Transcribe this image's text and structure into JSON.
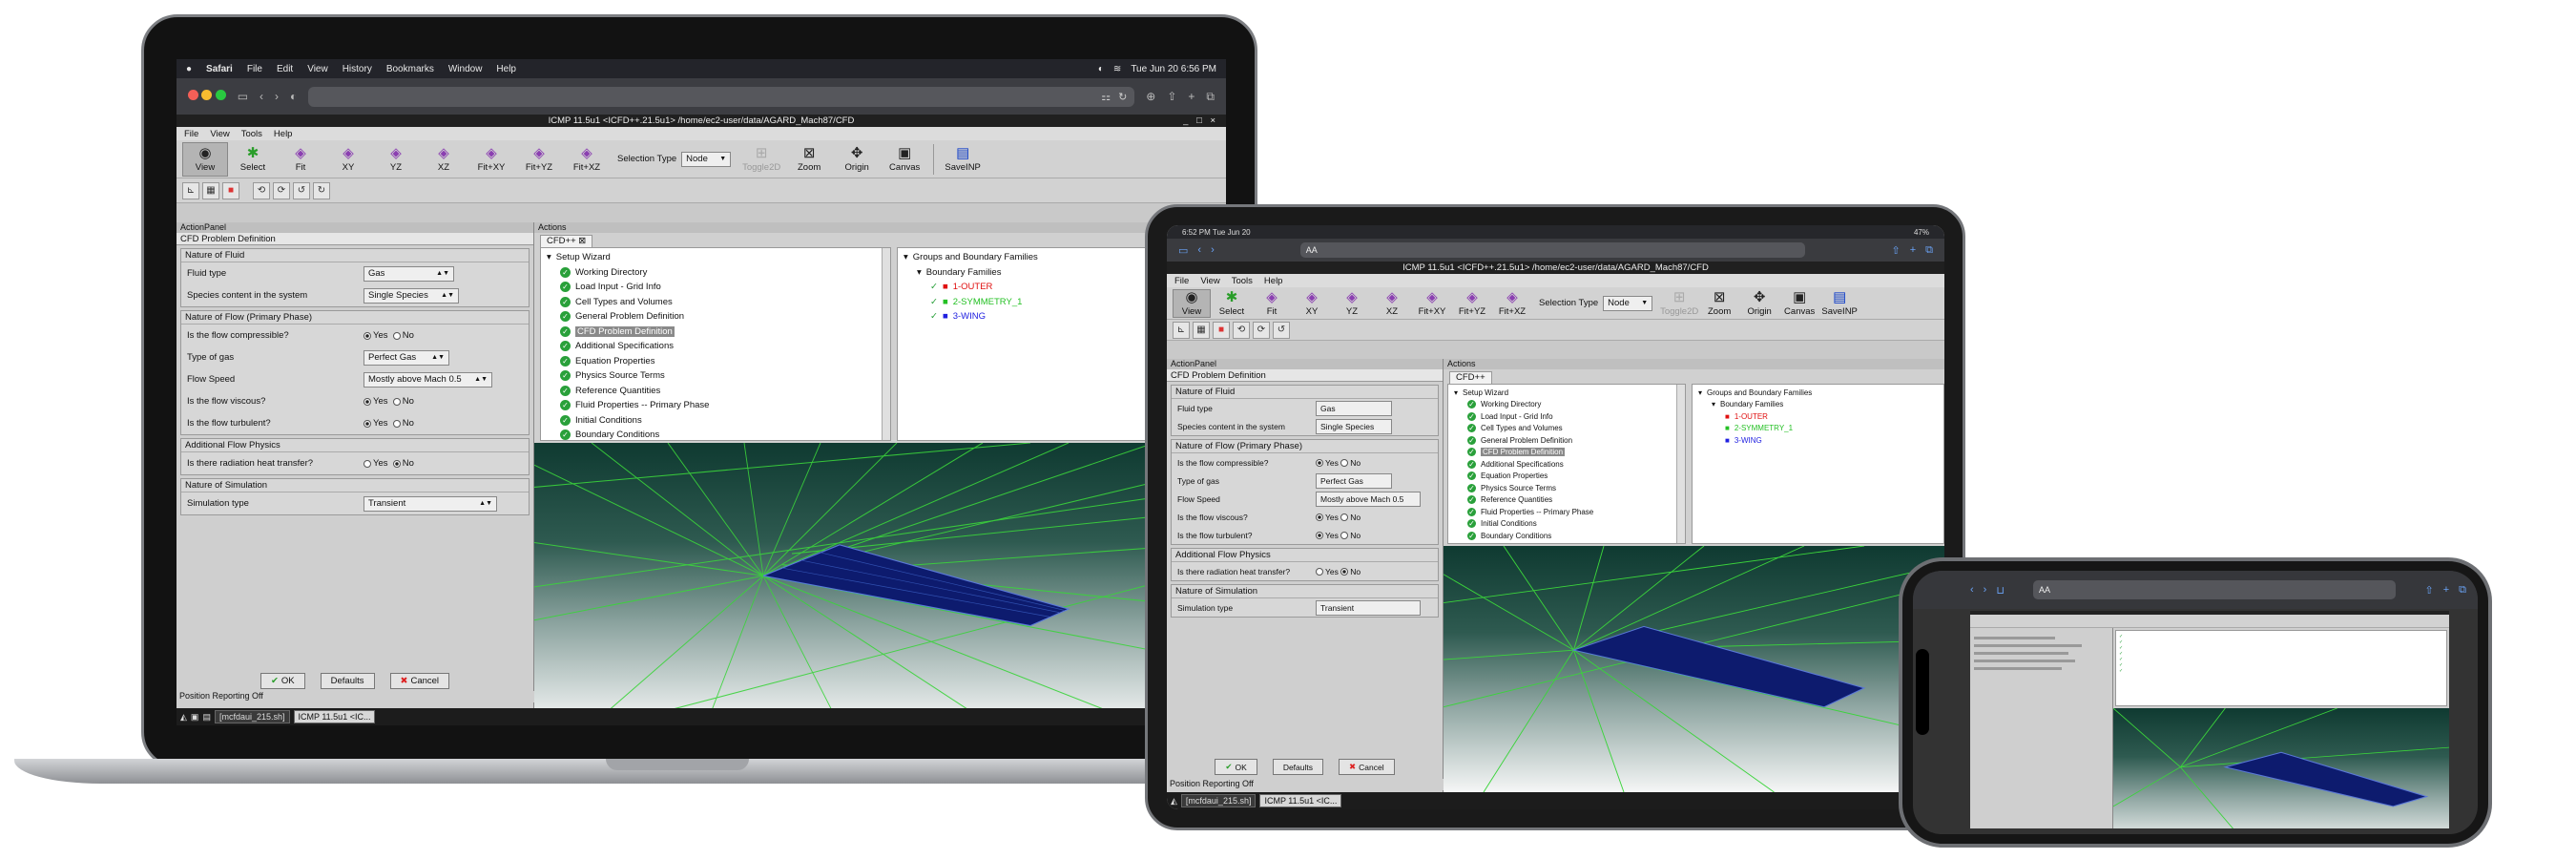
{
  "mac_menubar": {
    "app": "Safari",
    "items": [
      "File",
      "Edit",
      "View",
      "History",
      "Bookmarks",
      "Window",
      "Help"
    ],
    "clock": "Tue Jun 20  6:56 PM"
  },
  "window_title": "ICMP 11.5u1 <ICFD++.21.5u1>  /home/ec2-user/data/AGARD_Mach87/CFD",
  "app_menu": [
    "File",
    "View",
    "Tools",
    "Help"
  ],
  "toolbar": {
    "buttons": [
      {
        "label": "View",
        "icon": "eye-icon",
        "glyph": "👁"
      },
      {
        "label": "Select",
        "icon": "select-icon",
        "glyph": "✱"
      },
      {
        "label": "Fit",
        "icon": "fit-icon",
        "glyph": "⬚"
      },
      {
        "label": "XY",
        "icon": "xy-icon",
        "glyph": "◈"
      },
      {
        "label": "YZ",
        "icon": "yz-icon",
        "glyph": "◈"
      },
      {
        "label": "XZ",
        "icon": "xz-icon",
        "glyph": "◈"
      },
      {
        "label": "Fit+XY",
        "icon": "fit-xy-icon",
        "glyph": "◈"
      },
      {
        "label": "Fit+YZ",
        "icon": "fit-yz-icon",
        "glyph": "◈"
      },
      {
        "label": "Fit+XZ",
        "icon": "fit-xz-icon",
        "glyph": "◈"
      }
    ],
    "selection_type_label": "Selection Type",
    "selection_type_value": "Node",
    "toggle2d": "Toggle2D",
    "zoom": "Zoom",
    "origin": "Origin",
    "canvas": "Canvas",
    "saveinp": "SaveINP"
  },
  "action_panel": {
    "title": "ActionPanel",
    "heading": "CFD Problem Definition",
    "groups": {
      "fluid": {
        "title": "Nature of Fluid",
        "fluid_type_label": "Fluid type",
        "fluid_type_value": "Gas",
        "species_label": "Species content in the system",
        "species_value": "Single Species"
      },
      "flow": {
        "title": "Nature of Flow (Primary Phase)",
        "compressible_label": "Is the flow compressible?",
        "gas_label": "Type of gas",
        "gas_value": "Perfect Gas",
        "speed_label": "Flow Speed",
        "speed_value": "Mostly above Mach 0.5",
        "viscous_label": "Is the flow viscous?",
        "turbulent_label": "Is the flow turbulent?"
      },
      "physics": {
        "title": "Additional Flow Physics",
        "radiation_label": "Is there radiation heat transfer?"
      },
      "simulation": {
        "title": "Nature of Simulation",
        "type_label": "Simulation type",
        "type_value": "Transient"
      }
    },
    "yes": "Yes",
    "no": "No",
    "ok": "OK",
    "defaults": "Defaults",
    "cancel": "Cancel"
  },
  "position_status": "Position Reporting Off",
  "actions": {
    "title": "Actions",
    "tab": "CFD++",
    "wizard_root": "Setup Wizard",
    "wizard_steps": [
      "Working Directory",
      "Load Input - Grid Info",
      "Cell Types and Volumes",
      "General Problem Definition",
      "CFD Problem Definition",
      "Additional Specifications",
      "Equation Properties",
      "Physics Source Terms",
      "Reference Quantities",
      "Fluid Properties -- Primary Phase",
      "Initial Conditions",
      "Boundary Conditions"
    ],
    "groups_root": "Groups and Boundary Families",
    "families_root": "Boundary Families",
    "families": [
      "1-OUTER",
      "2-SYMMETRY_1",
      "3-WING"
    ]
  },
  "taskbar": {
    "item1": "[mcfdaui_215.sh]",
    "item2": "ICMP 11.5u1 <IC..."
  },
  "ipad": {
    "time": "6:52 PM  Tue Jun 20",
    "battery": "47%",
    "url_text": "AA"
  },
  "colors": {
    "accent_blue": "#3b78f0",
    "check_green": "#29a03a",
    "family_red": "#e01010",
    "family_green": "#24c024",
    "family_blue": "#2020e0"
  }
}
